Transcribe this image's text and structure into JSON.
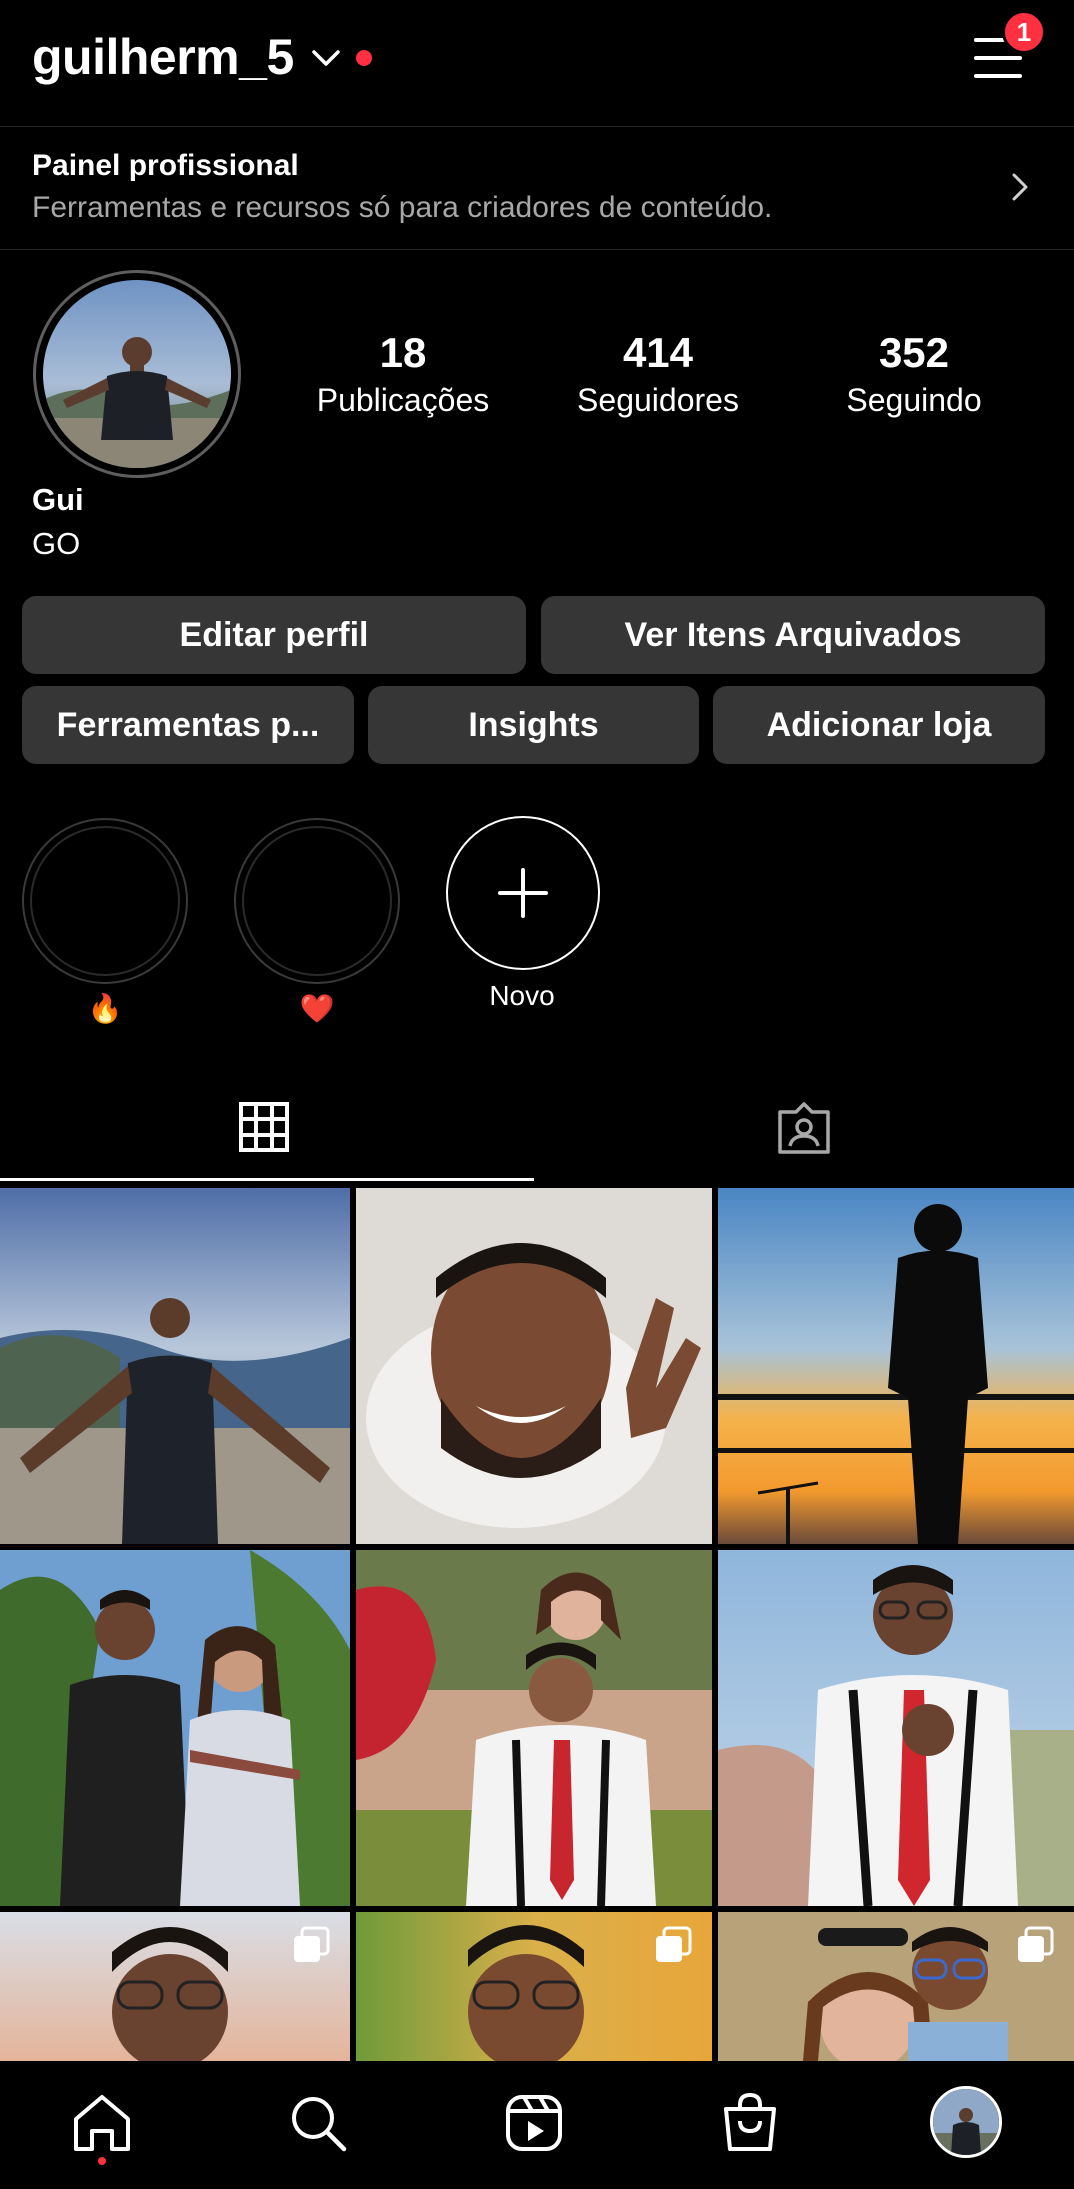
{
  "header": {
    "username": "guilherm_5",
    "notification_count": "1",
    "badge_color": "#ff3040",
    "live_dot_color": "#ff3040"
  },
  "pro_panel": {
    "title": "Painel profissional",
    "subtitle": "Ferramentas e recursos só para criadores de conteúdo."
  },
  "profile": {
    "stats": [
      {
        "value": "18",
        "label": "Publicações"
      },
      {
        "value": "414",
        "label": "Seguidores"
      },
      {
        "value": "352",
        "label": "Seguindo"
      }
    ],
    "name": "Gui",
    "bio": "GO"
  },
  "buttons": {
    "edit_profile": "Editar perfil",
    "archived": "Ver Itens Arquivados",
    "tools": "Ferramentas p...",
    "insights": "Insights",
    "add_shop": "Adicionar loja"
  },
  "highlights": [
    {
      "label": "🔥",
      "kind": "fire"
    },
    {
      "label": "❤️",
      "kind": "heart"
    },
    {
      "label": "Novo",
      "kind": "new"
    }
  ],
  "tabs": [
    {
      "name": "posts-grid-tab",
      "icon": "grid-icon",
      "active": true
    },
    {
      "name": "tagged-tab",
      "icon": "tagged-person-icon",
      "active": false
    }
  ],
  "posts": [
    {
      "scene": "man-overlook-sea",
      "multi": false
    },
    {
      "scene": "selfie-smile",
      "multi": false
    },
    {
      "scene": "sunset-silhouette",
      "multi": false
    },
    {
      "scene": "couple-palms",
      "multi": false
    },
    {
      "scene": "couple-balloons",
      "multi": false
    },
    {
      "scene": "man-red-tie",
      "multi": false
    },
    {
      "scene": "man-glasses-sky",
      "multi": true
    },
    {
      "scene": "man-glasses-yellow",
      "multi": true
    },
    {
      "scene": "couple-selfie",
      "multi": true
    }
  ],
  "bottom_nav": [
    {
      "name": "home",
      "icon": "home-icon"
    },
    {
      "name": "search",
      "icon": "search-icon"
    },
    {
      "name": "reels",
      "icon": "reels-icon"
    },
    {
      "name": "shop",
      "icon": "shopping-bag-icon"
    },
    {
      "name": "profile",
      "icon": "profile-avatar"
    }
  ],
  "colors": {
    "background": "#000000",
    "button": "#363636",
    "divider": "#262626",
    "secondary_text": "#a8a8a8"
  }
}
